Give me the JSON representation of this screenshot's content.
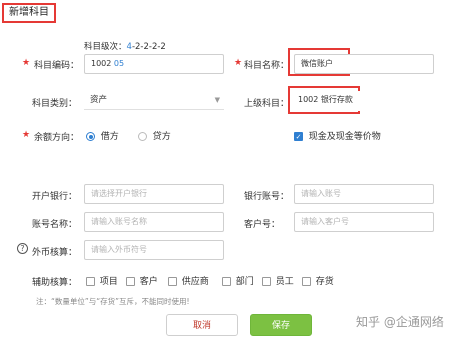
{
  "title": "新增科目",
  "level": {
    "prefix": "科目级次：",
    "highlight": "4",
    "rest": "-2-2-2-2"
  },
  "code": {
    "label": "科目编码：",
    "prefix": "1002 ",
    "suffix": "05"
  },
  "name": {
    "label": "科目名称：",
    "value": "微信账户"
  },
  "category": {
    "label": "科目类别：",
    "value": "资产"
  },
  "parent": {
    "label": "上级科目：",
    "value": "1002 银行存款"
  },
  "balance": {
    "label": "余额方向：",
    "debit": "借方",
    "credit": "贷方"
  },
  "cash": {
    "label": "现金及现金等价物"
  },
  "bank": {
    "label": "开户银行：",
    "placeholder": "请选择开户银行"
  },
  "bank_acct": {
    "label": "银行账号：",
    "placeholder": "请输入账号"
  },
  "acct_name": {
    "label": "账号名称：",
    "placeholder": "请输入账号名称"
  },
  "customer_no": {
    "label": "客户号：",
    "placeholder": "请输入客户号"
  },
  "currency": {
    "label": "外币核算：",
    "placeholder": "请输入外币符号"
  },
  "aux": {
    "label": "辅助核算：",
    "items": [
      "项目",
      "客户",
      "供应商",
      "部门",
      "员工",
      "存货"
    ]
  },
  "note": "注：“数量单位”与“存货”互斥，不能同时使用!",
  "buttons": {
    "cancel": "取消",
    "save": "保存"
  },
  "watermark": "知乎 @企通网络",
  "icons": {
    "select": "caret-down-icon",
    "help": "help-icon",
    "check": "checkmark-icon"
  },
  "colors": {
    "accent": "#2f7fd1",
    "required": "#e53935",
    "save": "#7cc142"
  }
}
